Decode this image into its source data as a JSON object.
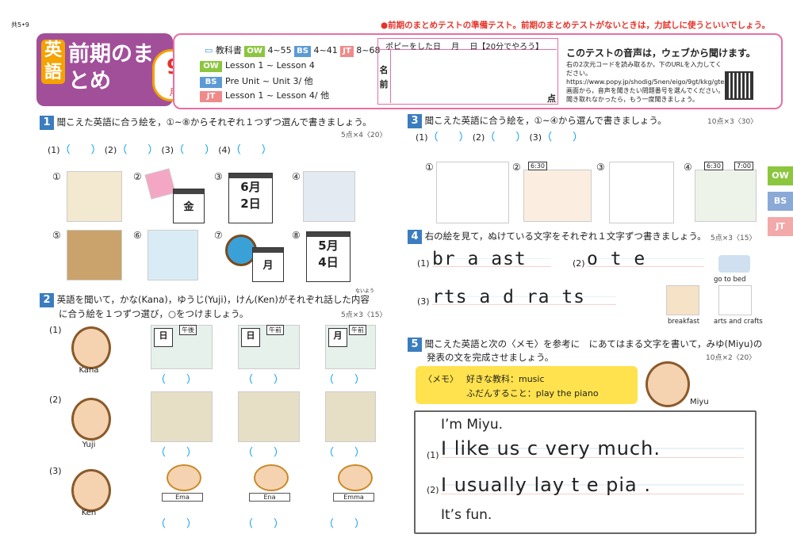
{
  "header": {
    "page_code": "共5•9",
    "notice": "●前期のまとめテストの準備テスト。前期のまとめテストがないときは，力試しに使うといいでしょう。",
    "eigo": "英語",
    "title": "前期のまとめ",
    "month_num": "9",
    "month_unit": "月",
    "textbook_label": "教科書",
    "ranges": [
      {
        "tag": "OW",
        "range": "4~55"
      },
      {
        "tag": "BS",
        "range": "4~41"
      },
      {
        "tag": "JT",
        "range": "8~68"
      }
    ],
    "lessons": [
      {
        "tag": "OW",
        "text": "Lesson 1 ~ Lesson 4"
      },
      {
        "tag": "BS",
        "text": "Pre Unit ~ Unit 3/ 他"
      },
      {
        "tag": "JT",
        "text": "Lesson 1 ~ Lesson 4/ 他"
      }
    ],
    "name_header": "ポピーをした日　 月　 日【20分でやろう】",
    "name_label": "名前",
    "points_label": "点",
    "audio_title": "このテストの音声は，ウェブから聞けます。",
    "audio_body": "右の2次元コードを読み取るか，下のURLを入力してください。 https://www.popy.jp/shodig/5nen/eigo/9gt/kkg/gtest/ 画面から，音声を聞きたい問題番号を選んでください。聞き取れなかったら，もう一度聞きましょう。",
    "colors": {
      "purple": "#a24f9a",
      "pink": "#e86fa3",
      "blue": "#3b7dbf",
      "orange": "#f4a300"
    }
  },
  "tabs": [
    "OW",
    "BS",
    "JT"
  ],
  "q1": {
    "num": "1",
    "text": "聞こえた英語に合う絵を，①~⑧からそれぞれ１つずつ選んで書きましょう。",
    "points": "5点×4〈20〉",
    "answers": [
      "(1)",
      "(2)",
      "(3)",
      "(4)"
    ],
    "pics": [
      "①",
      "②",
      "③",
      "④",
      "⑤",
      "⑥",
      "⑦",
      "⑧"
    ],
    "cal2": "金",
    "cal3a": "6月",
    "cal3b": "2日",
    "cal7": "月",
    "cal8a": "5月",
    "cal8b": "4日"
  },
  "q2": {
    "num": "2",
    "text1": "英語を聞いて，かな(Kana)，ゆうじ(Yuji)，けん(Ken)がそれぞれ話した内容",
    "text2": "に合う絵を１つずつ選び，○をつけましょう。",
    "ruby": "ないよう",
    "points": "5点×3〈15〉",
    "rows": [
      {
        "label": "(1)",
        "name": "Kana"
      },
      {
        "label": "(2)",
        "name": "Yuji"
      },
      {
        "label": "(3)",
        "name": "Ken"
      }
    ],
    "cards": [
      [
        "日",
        "午後"
      ],
      [
        "日",
        "午前"
      ],
      [
        "月",
        "午前"
      ]
    ],
    "signs": [
      "Ema",
      "Ena",
      "Emma"
    ]
  },
  "q3": {
    "num": "3",
    "text": "聞こえた英語に合う絵を，①~④から選んで書きましょう。",
    "points": "10点×3〈30〉",
    "answers": [
      "(1)",
      "(2)",
      "(3)"
    ],
    "pics": [
      "①",
      "②",
      "③",
      "④"
    ],
    "times": [
      "6:30",
      "6:30",
      "7:00"
    ]
  },
  "q4": {
    "num": "4",
    "text": "右の絵を見て，ぬけている文字をそれぞれ１文字ずつ書きましょう。",
    "points": "5点×3〈15〉",
    "w1": "br a ast",
    "w2": "o t e",
    "w3": "rts a d ra ts",
    "labels": [
      "(1)",
      "(2)",
      "(3)"
    ],
    "captions": [
      "go to bed",
      "breakfast",
      "arts and crafts"
    ]
  },
  "q5": {
    "num": "5",
    "text1": "聞こえた英語と次の〈メモ〉を参考に　にあてはまる文字を書いて，みゆ(Miyu)の",
    "text2": "発表の文を完成させましょう。",
    "points": "10点×2〈20〉",
    "memo_title": "〈メモ〉",
    "memo1": "好きな教科：music",
    "memo2": "ふだんすること：play the piano",
    "miyu": "Miyu",
    "line0": "I’m Miyu.",
    "line1": "I like  us c very much.",
    "line2": "I usually  lay t e pia  .",
    "line3": "It’s fun.",
    "labels": [
      "(1)",
      "(2)"
    ]
  }
}
